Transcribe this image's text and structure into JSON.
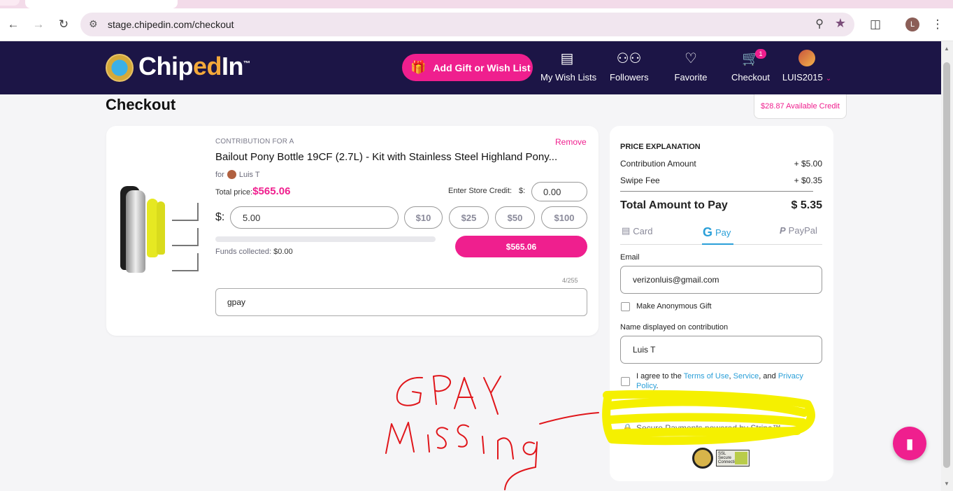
{
  "browser": {
    "url": "stage.chipedin.com/checkout",
    "profile_initial": "L"
  },
  "header": {
    "logo_prefix": "Chip",
    "logo_accent": "ed",
    "logo_suffix": "In",
    "logo_tm": "™",
    "add_gift_label": "Add Gift or Wish List",
    "nav": [
      {
        "label": "My Wish Lists",
        "icon": "wishlist-icon"
      },
      {
        "label": "Followers",
        "icon": "followers-icon"
      },
      {
        "label": "Favorite",
        "icon": "heart-icon"
      },
      {
        "label": "Checkout",
        "icon": "cart-icon"
      },
      {
        "label": "LUIS2015",
        "icon": "user-avatar"
      }
    ],
    "cart_count": "1",
    "colors": {
      "header_bg": "#1c1546",
      "accent": "#ef1f8e"
    }
  },
  "page": {
    "title": "Checkout",
    "available_credit": "$28.87 Available Credit"
  },
  "item": {
    "contribution_label": "CONTRIBUTION FOR A",
    "remove_label": "Remove",
    "title": "Bailout Pony Bottle 19CF (2.7L) - Kit with Stainless Steel Highland Pony...",
    "for_label": "for",
    "for_name": "Luis T",
    "total_price_label": "Total price:",
    "total_price": "$565.06",
    "store_credit_label": "Enter Store Credit:",
    "store_credit_currency": "$:",
    "store_credit_value": "0.00",
    "amount_currency": "$:",
    "amount_value": "5.00",
    "presets": [
      "$10",
      "$25",
      "$50",
      "$100"
    ],
    "funds_label": "Funds collected:",
    "funds_value": "$0.00",
    "funds_progress": 0,
    "price_button": "$565.06",
    "char_count": "4/255",
    "message_value": "gpay"
  },
  "payment": {
    "section_title": "PRICE EXPLANATION",
    "rows": [
      {
        "label": "Contribution Amount",
        "value": "+ $5.00"
      },
      {
        "label": "Swipe Fee",
        "value": "+ $0.35"
      }
    ],
    "total_label": "Total Amount to Pay",
    "total_value": "$ 5.35",
    "tabs": [
      {
        "label": "Card",
        "icon": "card-icon",
        "active": false
      },
      {
        "label": "Pay",
        "icon": "google-g-icon",
        "active": true
      },
      {
        "label": "PayPal",
        "icon": "paypal-icon",
        "active": false
      }
    ],
    "email_label": "Email",
    "email_value": "verizonluis@gmail.com",
    "anonymous_label": "Make Anonymous Gift",
    "name_label": "Name displayed on contribution",
    "name_value": "Luis T",
    "terms_prefix": "I agree to the",
    "terms_link1": "Terms of Use",
    "terms_sep1": ",",
    "terms_link2": "Service",
    "terms_sep2": ", and",
    "terms_link3": "Privacy Policy",
    "terms_end": ".",
    "secure_text": "Secure Payments powered by Stripe™",
    "ssl_text": "SSL Secure Connection"
  },
  "annotation": {
    "handwritten": "GPAY Missing",
    "colors": {
      "ink": "#e0161b",
      "highlight": "#f5f000"
    }
  }
}
